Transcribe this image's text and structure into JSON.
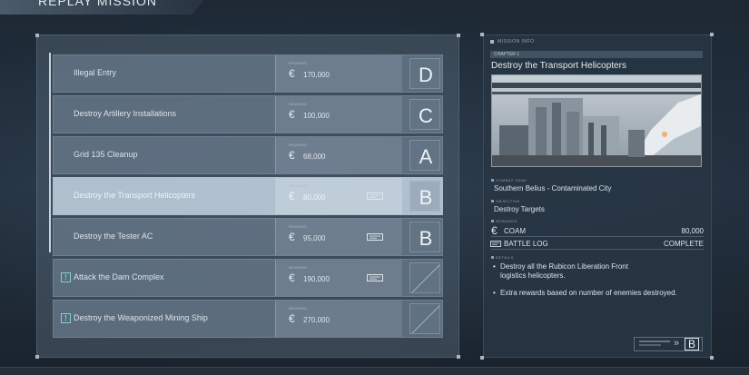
{
  "page": {
    "title": "REPLAY MISSION"
  },
  "missions": [
    {
      "name": "Illegal Entry",
      "reward_label": "REWARD",
      "reward": "170,000",
      "grade": "D",
      "locked": false,
      "battle_log": false
    },
    {
      "name": "Destroy Artillery Installations",
      "reward_label": "REWARD",
      "reward": "100,000",
      "grade": "C",
      "locked": false,
      "battle_log": false
    },
    {
      "name": "Grid 135 Cleanup",
      "reward_label": "REWARD",
      "reward": "68,000",
      "grade": "A",
      "locked": false,
      "battle_log": false
    },
    {
      "name": "Destroy the Transport Helicopters",
      "reward_label": "REWARD",
      "reward": "80,000",
      "grade": "B",
      "locked": false,
      "battle_log": true,
      "selected": true
    },
    {
      "name": "Destroy the Tester AC",
      "reward_label": "REWARD",
      "reward": "95,000",
      "grade": "B",
      "locked": false,
      "battle_log": true
    },
    {
      "name": "Attack the Dam Complex",
      "reward_label": "REWARD",
      "reward": "190,000",
      "grade": "",
      "locked": true,
      "battle_log": true
    },
    {
      "name": "Destroy the Weaponized Mining Ship",
      "reward_label": "REWARD",
      "reward": "270,000",
      "grade": "",
      "locked": true,
      "battle_log": false
    }
  ],
  "currency_symbol": "€",
  "warning_glyph": "!",
  "info": {
    "header": "MISSION INFO",
    "chapter": "CHAPTER 1",
    "title": "Destroy the Transport Helicopters",
    "combat_zone_label": "COMBAT ZONE",
    "combat_zone": "Southern Belius - Contaminated City",
    "objective_label": "OBJECTIVE",
    "objective": "Destroy Targets",
    "rewards_label": "REWARDS",
    "coam_label": "COAM",
    "coam_value": "80,000",
    "battle_log_label": "BATTLE LOG",
    "battle_log_value": "COMPLETE",
    "details_label": "DETAILS",
    "details": [
      "Destroy all the Rubicon Liberation Front",
      "logistics helicopters.",
      "Extra rewards based on number of enemies destroyed."
    ],
    "bullet": "•",
    "footer_chevrons": "»",
    "footer_grade": "B"
  },
  "colors": {
    "accent_teal": "#7fd3c9",
    "selected_row": "#c4d4e2",
    "panel": "#4e5e6e"
  },
  "icons": {
    "warning": "warning-icon",
    "battle_log": "battle-log-icon",
    "currency": "euro-icon"
  }
}
